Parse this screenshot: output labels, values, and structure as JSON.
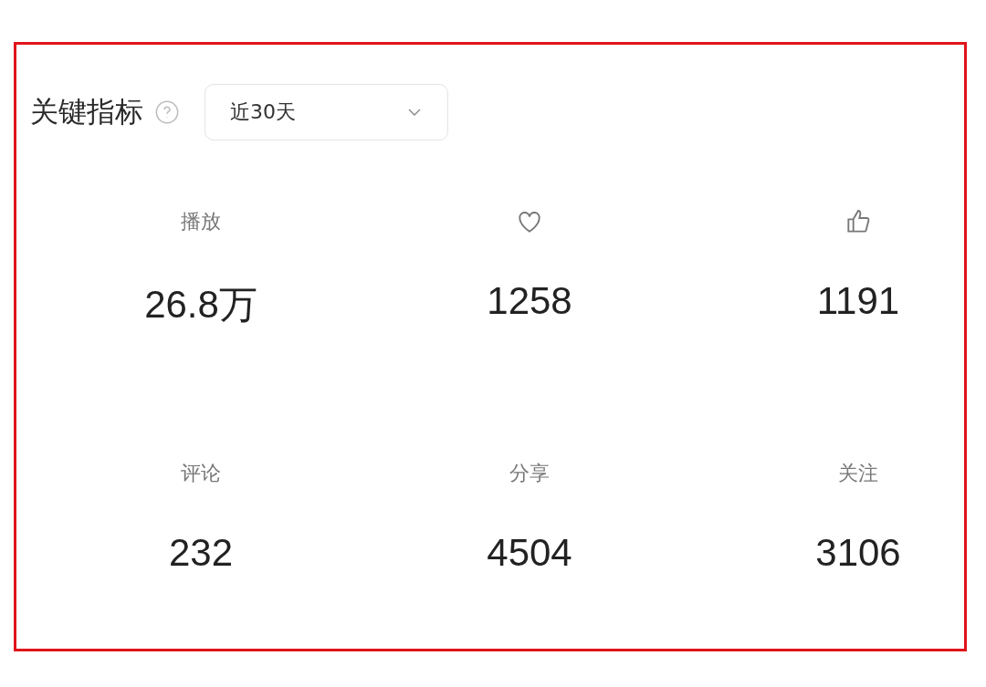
{
  "header": {
    "title": "关键指标",
    "period": {
      "value": "近30天"
    }
  },
  "metrics": [
    {
      "kind": "label",
      "label": "播放",
      "value": "26.8万"
    },
    {
      "kind": "heart",
      "value": "1258"
    },
    {
      "kind": "thumb",
      "value": "1191"
    },
    {
      "kind": "label",
      "label": "评论",
      "value": "232"
    },
    {
      "kind": "label",
      "label": "分享",
      "value": "4504"
    },
    {
      "kind": "label",
      "label": "关注",
      "value": "3106"
    }
  ]
}
